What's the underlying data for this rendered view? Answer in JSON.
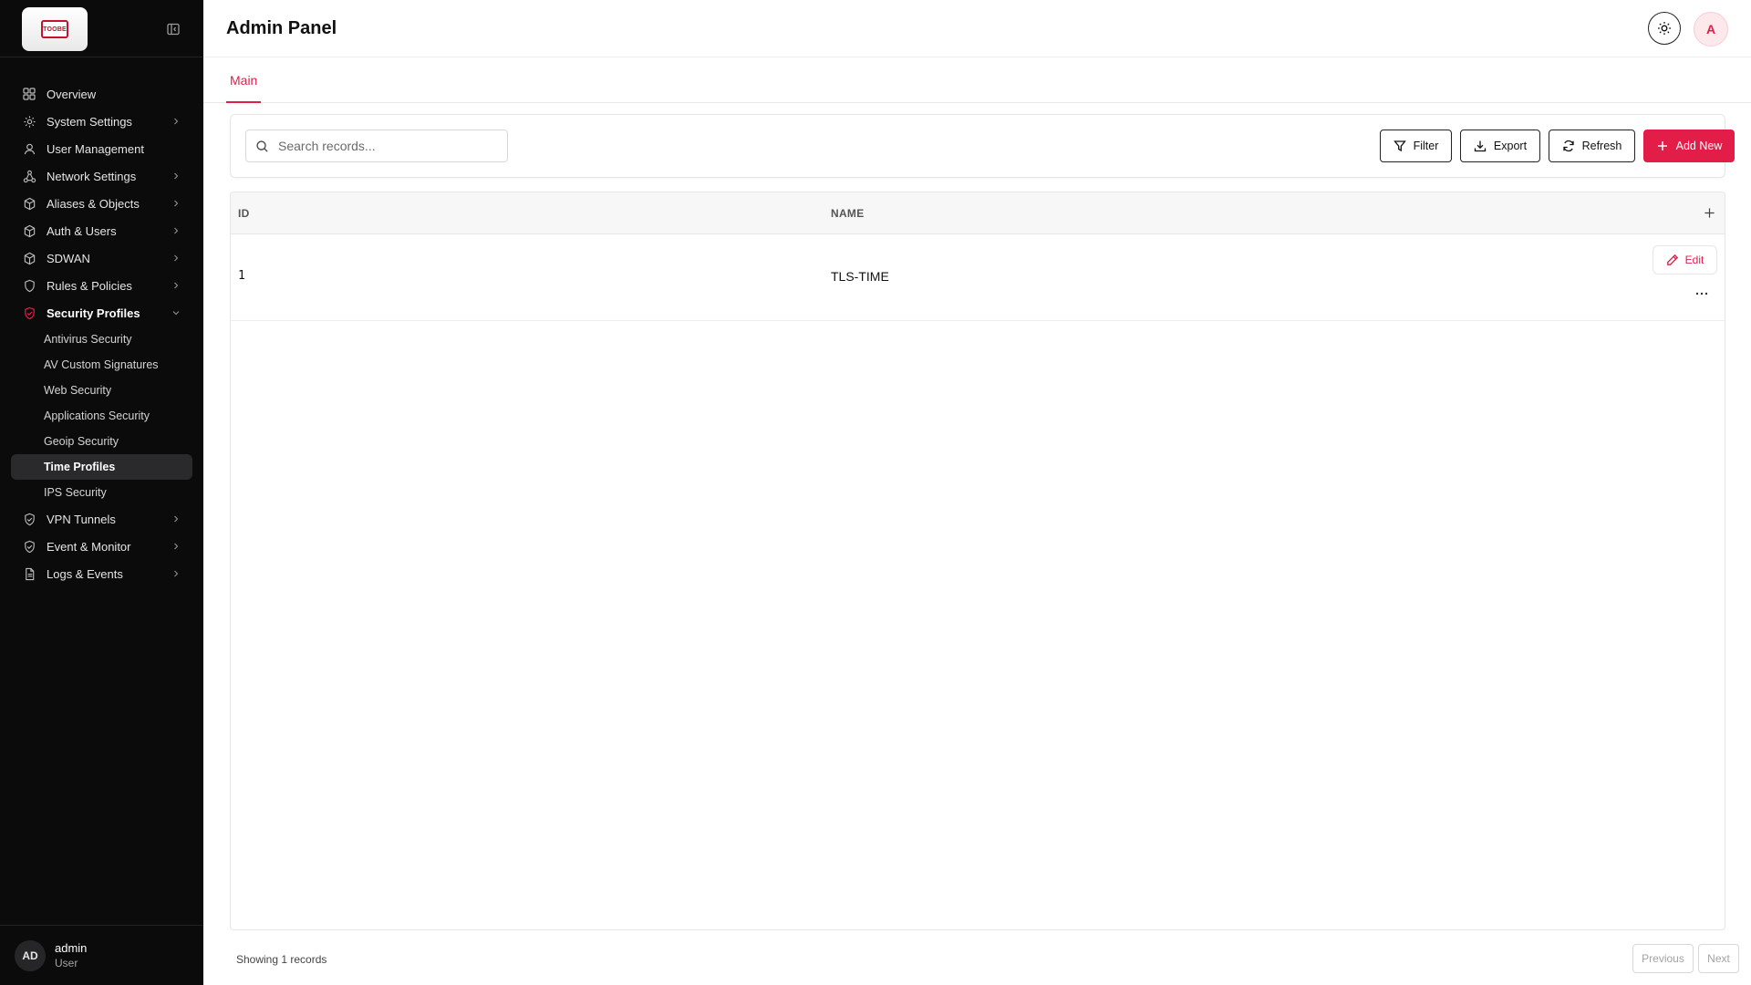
{
  "app": {
    "title": "Admin Panel",
    "logo_text": "TOOBE"
  },
  "colors": {
    "accent": "#e11d48",
    "sidebar_bg": "#0b0b0c",
    "active_item_bg": "#2a2a2d"
  },
  "sidebar": {
    "items": [
      {
        "label": "Overview",
        "icon": "grid-icon",
        "chevron": false
      },
      {
        "label": "System Settings",
        "icon": "gear-icon",
        "chevron": true
      },
      {
        "label": "User Management",
        "icon": "user-icon",
        "chevron": false
      },
      {
        "label": "Network Settings",
        "icon": "network-icon",
        "chevron": true
      },
      {
        "label": "Aliases & Objects",
        "icon": "cube-icon",
        "chevron": true
      },
      {
        "label": "Auth & Users",
        "icon": "cube-icon",
        "chevron": true
      },
      {
        "label": "SDWAN",
        "icon": "cube-icon",
        "chevron": true
      },
      {
        "label": "Rules & Policies",
        "icon": "shield-icon",
        "chevron": true
      },
      {
        "label": "Security Profiles",
        "icon": "shield-check-icon",
        "chevron": true,
        "expanded": true
      }
    ],
    "sub_items": [
      {
        "label": "Antivirus Security"
      },
      {
        "label": "AV Custom Signatures"
      },
      {
        "label": "Web Security"
      },
      {
        "label": "Applications Security"
      },
      {
        "label": "Geoip Security"
      },
      {
        "label": "Time Profiles",
        "active": true
      },
      {
        "label": "IPS Security"
      }
    ],
    "items_after": [
      {
        "label": "VPN Tunnels",
        "icon": "shield-check-icon",
        "chevron": true
      },
      {
        "label": "Event & Monitor",
        "icon": "shield-check-icon",
        "chevron": true
      },
      {
        "label": "Logs & Events",
        "icon": "document-icon",
        "chevron": true
      }
    ],
    "user": {
      "initials": "AD",
      "name": "admin",
      "role": "User"
    }
  },
  "header": {
    "avatar_initial": "A"
  },
  "tabs": [
    {
      "label": "Main",
      "active": true
    }
  ],
  "toolbar": {
    "search_placeholder": "Search records...",
    "filter_label": "Filter",
    "export_label": "Export",
    "refresh_label": "Refresh",
    "add_label": "Add New"
  },
  "table": {
    "columns": [
      "ID",
      "NAME"
    ],
    "rows": [
      {
        "id": "1",
        "name": "TLS-TIME",
        "edit_label": "Edit"
      }
    ]
  },
  "footer": {
    "showing_text": "Showing 1 records",
    "previous_label": "Previous",
    "next_label": "Next"
  }
}
